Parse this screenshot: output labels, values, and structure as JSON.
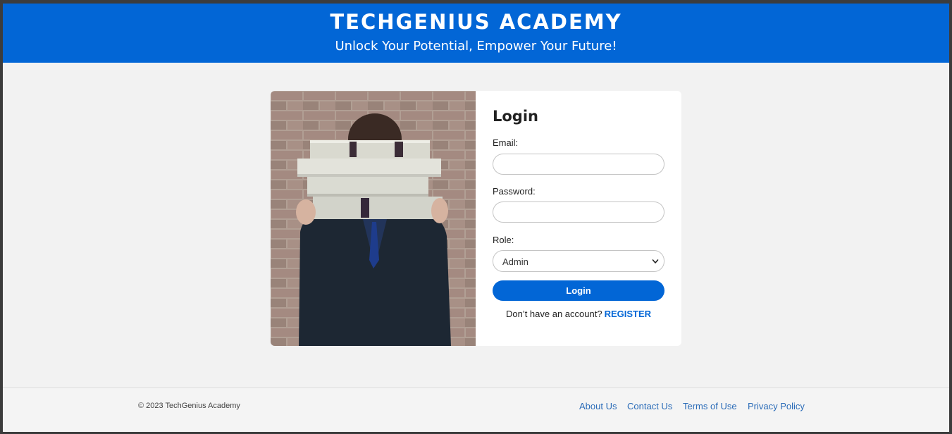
{
  "header": {
    "title": "TECHGENIUS ACADEMY",
    "subtitle": "Unlock Your Potential, Empower Your Future!"
  },
  "login": {
    "heading": "Login",
    "email_label": "Email:",
    "email_value": "",
    "password_label": "Password:",
    "password_value": "",
    "role_label": "Role:",
    "role_selected": "Admin",
    "submit_label": "Login",
    "register_prompt": "Don’t have an account?",
    "register_link": "REGISTER"
  },
  "footer": {
    "copyright": "© 2023 TechGenius Academy",
    "links": [
      "About Us",
      "Contact Us",
      "Terms of Use",
      "Privacy Policy"
    ]
  },
  "colors": {
    "brand_blue": "#0266d6",
    "page_bg": "#f2f2f2",
    "link": "#2b6cb8"
  },
  "icons": {
    "role_dropdown": "chevron-down-icon"
  }
}
